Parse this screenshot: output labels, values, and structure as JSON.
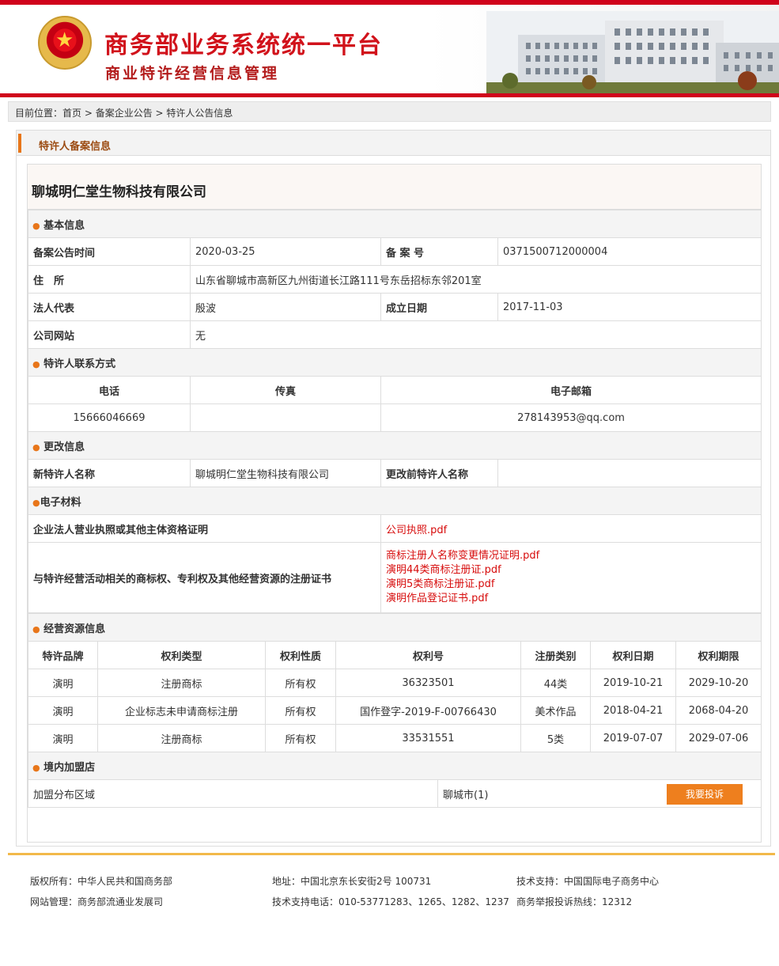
{
  "header": {
    "title": "商务部业务系统统一平台",
    "subtitle": "商业特许经营信息管理"
  },
  "breadcrumb": {
    "prefix": "目前位置：",
    "items": [
      "首页",
      "备案企业公告",
      "特许人公告信息"
    ],
    "separator": " > "
  },
  "panel": {
    "title": "特许人备案信息"
  },
  "company_name": "聊城明仁堂生物科技有限公司",
  "basic": {
    "section": "基本信息",
    "record_date_label": "备案公告时间",
    "record_date": "2020-03-25",
    "record_no_label": "备 案 号",
    "record_no": "0371500712000004",
    "address_label": "住　所",
    "address": "山东省聊城市高新区九州街道长江路111号东岳招标东邻201室",
    "legal_rep_label": "法人代表",
    "legal_rep": "殷波",
    "established_label": "成立日期",
    "established": "2017-11-03",
    "website_label": "公司网站",
    "website": "无"
  },
  "contact": {
    "section": "特许人联系方式",
    "headers": [
      "电话",
      "传真",
      "电子邮箱"
    ],
    "phone": "15666046669",
    "fax": "",
    "email": "278143953@qq.com"
  },
  "change": {
    "section": "更改信息",
    "new_label": "新特许人名称",
    "new_value": "聊城明仁堂生物科技有限公司",
    "old_label": "更改前特许人名称",
    "old_value": ""
  },
  "materials": {
    "section": "电子材料",
    "license_label": "企业法人营业执照或其他主体资格证明",
    "license_files": [
      "公司执照.pdf"
    ],
    "rights_label": "与特许经营活动相关的商标权、专利权及其他经营资源的注册证书",
    "rights_files": [
      "商标注册人名称变更情况证明.pdf",
      "演明44类商标注册证.pdf",
      "演明5类商标注册证.pdf",
      "演明作品登记证书.pdf"
    ]
  },
  "resources": {
    "section": "经营资源信息",
    "headers": [
      "特许品牌",
      "权利类型",
      "权利性质",
      "权利号",
      "注册类别",
      "权利日期",
      "权利期限"
    ],
    "rows": [
      [
        "演明",
        "注册商标",
        "所有权",
        "36323501",
        "44类",
        "2019-10-21",
        "2029-10-20"
      ],
      [
        "演明",
        "企业标志未申请商标注册",
        "所有权",
        "国作登字-2019-F-00766430",
        "美术作品",
        "2018-04-21",
        "2068-04-20"
      ],
      [
        "演明",
        "注册商标",
        "所有权",
        "33531551",
        "5类",
        "2019-07-07",
        "2029-07-06"
      ]
    ]
  },
  "stores": {
    "section": "境内加盟店",
    "region_label": "加盟分布区域",
    "region_value": "聊城市(1)"
  },
  "complaint_button": "我要投诉",
  "footer": {
    "copyright": "版权所有：中华人民共和国商务部",
    "address": "地址：中国北京东长安街2号 100731",
    "tech_support": "技术支持：中国国际电子商务中心",
    "site_admin": "网站管理：商务部流通业发展司",
    "tech_phone": "技术支持电话：010-53771283、1265、1282、1237",
    "hotline": "商务举报投诉热线：12312"
  },
  "colors": {
    "brand_red": "#d0021b",
    "accent_orange": "#ee7f1e",
    "link_red": "#d70c0c"
  }
}
